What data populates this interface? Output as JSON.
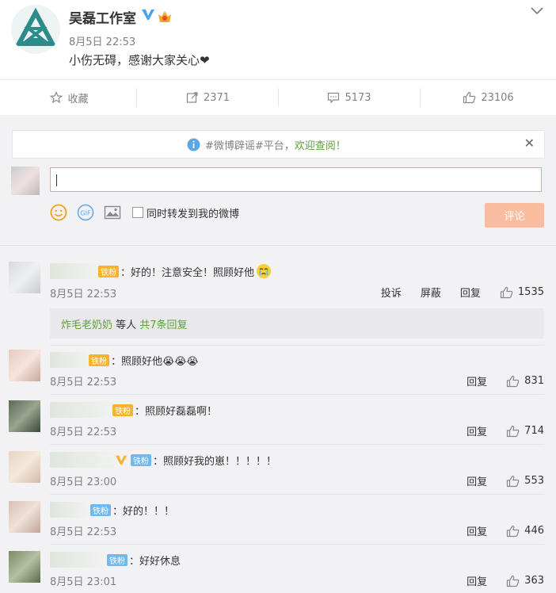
{
  "post": {
    "author": "吴磊工作室",
    "time": "8月5日 22:53",
    "text": "小伤无碍，感谢大家关心❤"
  },
  "actions": {
    "favorite": "收藏",
    "repost_count": "2371",
    "comment_count": "5173",
    "like_count": "23106"
  },
  "notice": {
    "prefix": "#微博辟谣#平台，",
    "link": "欢迎查阅！"
  },
  "composer": {
    "forward_label": "同时转发到我的微博",
    "submit_label": "评论"
  },
  "colors": {
    "accent_orange": "#f5a56b",
    "link_green": "#5e9f3a",
    "badge_gold": "#f7b32b",
    "badge_blue": "#6fb9f1"
  },
  "comments": [
    {
      "badge": "铁粉",
      "text": "：好的！注意安全！照顾好他",
      "time": "8月5日 22:53",
      "report": "投诉",
      "block": "屏蔽",
      "reply": "回复",
      "likes": "1535"
    },
    {
      "badge": "铁粉",
      "text": "：照顾好他😭😭😭",
      "time": "8月5日 22:53",
      "reply": "回复",
      "likes": "831"
    },
    {
      "badge": "铁粉",
      "text": "：照顾好磊磊啊！",
      "time": "8月5日 22:53",
      "reply": "回复",
      "likes": "714"
    },
    {
      "badge": "铁粉",
      "text": "：照顾好我的崽！！！！！",
      "time": "8月5日 23:00",
      "reply": "回复",
      "likes": "553"
    },
    {
      "badge": "铁粉",
      "text": "：好的！！！",
      "time": "8月5日 22:53",
      "reply": "回复",
      "likes": "446"
    },
    {
      "badge": "铁粉",
      "text": "：好好休息",
      "time": "8月5日 23:01",
      "reply": "回复",
      "likes": "363"
    }
  ],
  "reply_summary": {
    "user": "炸毛老奶奶",
    "mid": " 等人 ",
    "link": "共7条回复"
  }
}
